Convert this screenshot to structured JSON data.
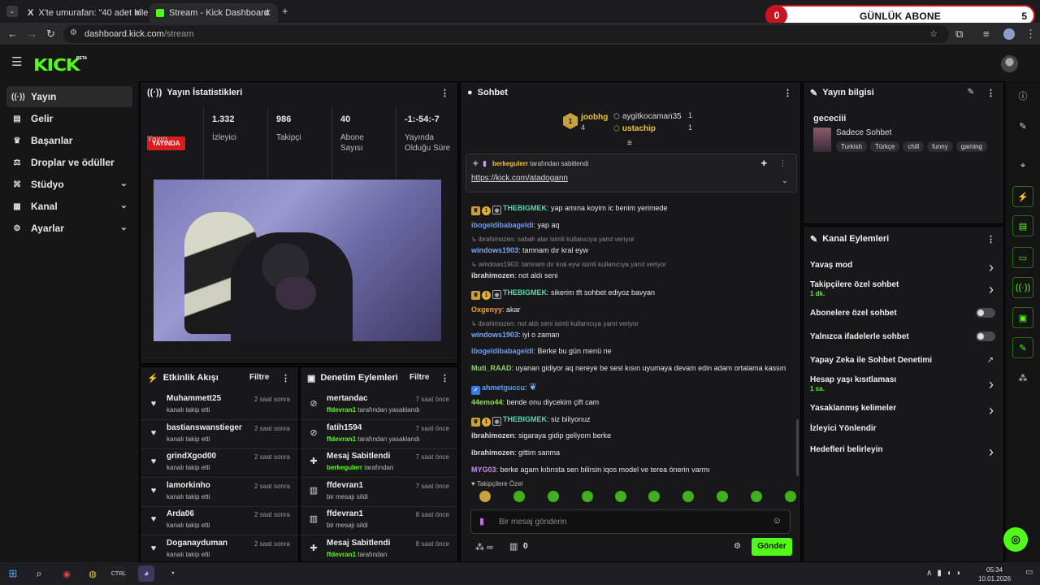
{
  "browser": {
    "tabs": [
      {
        "title": "X'te umurafan: \"40 adet bilet iç"
      },
      {
        "title": "Stream - Kick Dashboard"
      }
    ],
    "url_host": "dashboard.kick.com",
    "url_path": "/stream"
  },
  "overlay": {
    "count": "0",
    "label": "GÜNLÜK ABONE",
    "goal": "5"
  },
  "brand": {
    "logo": "KICK",
    "tag": "BETA"
  },
  "sidebar": {
    "items": [
      {
        "label": "Yayın"
      },
      {
        "label": "Gelir"
      },
      {
        "label": "Başarılar"
      },
      {
        "label": "Droplar ve ödüller"
      },
      {
        "label": "Stüdyo"
      },
      {
        "label": "Kanal"
      },
      {
        "label": "Ayarlar"
      }
    ]
  },
  "stats": {
    "title": "Yayın İstatistikleri",
    "live_badge": "YAYINDA",
    "live_label": "Yayın",
    "viewers": "1.332",
    "viewers_label": "İzleyici",
    "followers": "986",
    "followers_label": "Takipçi",
    "subs": "40",
    "subs_label": "Abone Sayısı",
    "uptime": "-1:-54:-7",
    "uptime_label": "Yayında Olduğu Süre"
  },
  "activity": {
    "title": "Etkinlik Akışı",
    "filter": "Filtre",
    "rows": [
      {
        "name": "Muhammett25",
        "sub": "kanalı takip etti",
        "time": "2 saat sonra"
      },
      {
        "name": "bastianswanstieger",
        "sub": "kanalı takip etti",
        "time": "2 saat sonra"
      },
      {
        "name": "grindXgod00",
        "sub": "kanalı takip etti",
        "time": "2 saat sonra"
      },
      {
        "name": "lamorkinho",
        "sub": "kanalı takip etti",
        "time": "2 saat sonra"
      },
      {
        "name": "Arda06",
        "sub": "kanalı takip etti",
        "time": "2 saat sonra"
      },
      {
        "name": "Doganayduman",
        "sub": "kanalı takip etti",
        "time": "2 saat sonra"
      }
    ]
  },
  "moderation": {
    "title": "Denetim Eylemleri",
    "filter": "Filtre",
    "rows": [
      {
        "name": "mertandac",
        "user": "ffdevran1",
        "sub": " tarafından yasaklandı",
        "time": "7 saat önce"
      },
      {
        "name": "fatih1594",
        "user": "ffdevran1",
        "sub": " tarafından yasaklandı",
        "time": "7 saat önce"
      },
      {
        "name": "Mesaj Sabitlendi",
        "user": "berkegulerr",
        "sub": " tarafından",
        "time": "7 saat önce"
      },
      {
        "name": "ffdevran1",
        "user": "",
        "sub": "bir mesajı sildi",
        "time": "7 saat önce"
      },
      {
        "name": "ffdevran1",
        "user": "",
        "sub": "bir mesajı sildi",
        "time": "8 saat önce"
      },
      {
        "name": "Mesaj Sabitlendi",
        "user": "ffdevran1",
        "sub": " tarafından",
        "time": "8 saat önce"
      }
    ]
  },
  "chat": {
    "title": "Sohbet",
    "top": [
      {
        "name": "joobhg",
        "count": "4"
      },
      {
        "name": "aygitkocaman35",
        "count": "1"
      },
      {
        "name": "ustachip",
        "count": "1"
      }
    ],
    "pinned_by": "berkegulerr",
    "pinned_suffix": " tarafından sabitlendi",
    "pinned_link": "https://kick.com/atadogann",
    "messages": [
      {
        "user": "THEBIGMEK",
        "text": ": yap amına koyim ic benim yerimede"
      },
      {
        "user": "ibogeldibabageldi",
        "text": ": yap aq"
      },
      {
        "reply": "↳ ibrahimozen: sabah atar isimli kullanıcıya yanıt veriyor"
      },
      {
        "user": "windows1903",
        "text": ": tamnam dır kral eyw"
      },
      {
        "reply": "↳ windows1903: tamnam dır kral eyw isimli kullanıcıya yanıt veriyor"
      },
      {
        "user": "ibrahimozen",
        "text": ": not aldı seni"
      },
      {
        "user": "THEBIGMEK",
        "text": ": sikerim tft sohbet ediyoz bavyan"
      },
      {
        "user": "Oxgenyy",
        "text": ": akar"
      },
      {
        "reply": "↳ ibrahimozen: not aldı seni isimli kullanıcıya yanıt veriyor"
      },
      {
        "user": "windows1903",
        "text": ": iyi o zaman"
      },
      {
        "user": "ibogeldibabageldi",
        "text": ": Berke bu gün menü ne"
      },
      {
        "user": "Muti_RAAD",
        "text": ": uyanan gidiyor aq nereye be sesi kısın uyumaya devam edin adam ortalama kassın"
      },
      {
        "user": "ahmetguccu",
        "text": ":"
      },
      {
        "user": "44emo44",
        "text": ": bende onu diycekim çift cam"
      },
      {
        "user": "THEBIGMEK",
        "text": ": siz biliyonuz"
      },
      {
        "user": "ibrahimozen",
        "text": ": sigaraya gidip geliyom berke"
      },
      {
        "user": "ibrahimozen",
        "text": ": gittim sanma"
      },
      {
        "user": "MYG03",
        "text": ": berke agam kıbrısta sen bilirsin iqos model ve terea önerin varmı"
      }
    ],
    "emote_label": "Takipçilere Özel",
    "input_placeholder": "Bir mesaj gönderin",
    "bottom_count": "0",
    "send": "Gönder",
    "colors": {
      "THEBIGMEK": "#5fd4b4",
      "ibogeldibabageldi": "#6f9cf0",
      "windows1903": "#7ca4f0",
      "ibrahimozen": "#d8d8d8",
      "Oxgenyy": "#f0a030",
      "Muti_RAAD": "#8fd16a",
      "ahmetguccu": "#5aa0f0",
      "44emo44": "#8fe04a",
      "MYG03": "#c98ff0"
    }
  },
  "streaminfo": {
    "title": "Yayın bilgisi",
    "stream_title": "gececiii",
    "category": "Sadece Sohbet",
    "tags": [
      "Turkish",
      "Türkçe",
      "chill",
      "funny",
      "gaming"
    ]
  },
  "channel_actions": {
    "title": "Kanal Eylemleri",
    "items": [
      {
        "label": "Yavaş mod",
        "sub": "",
        "control": "chevron"
      },
      {
        "label": "Takipçilere özel sohbet",
        "sub": "1 dk.",
        "control": "chevron"
      },
      {
        "label": "Abonelere özel sohbet",
        "sub": "",
        "control": "toggle"
      },
      {
        "label": "Yalnızca ifadelerle sohbet",
        "sub": "",
        "control": "toggle"
      },
      {
        "label": "Yapay Zeka ile Sohbet Denetimi",
        "sub": "",
        "control": "chart"
      },
      {
        "label": "Hesap yaşı kısıtlaması",
        "sub": "1 sa.",
        "control": "chevron"
      },
      {
        "label": "Yasaklanmış kelimeler",
        "sub": "",
        "control": "chevron"
      },
      {
        "label": "İzleyici Yönlendir",
        "sub": "",
        "control": "none"
      },
      {
        "label": "Hedefleri belirleyin",
        "sub": "",
        "control": "chevron"
      }
    ]
  },
  "taskbar": {
    "time": "05:34",
    "date": "10.01.2026"
  }
}
